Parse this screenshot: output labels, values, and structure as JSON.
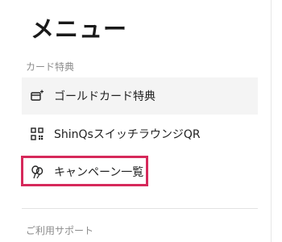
{
  "menu": {
    "title": "メニュー",
    "section_card": "カード特典",
    "section_support": "ご利用サポート",
    "items": [
      {
        "label": "ゴールドカード特典",
        "icon": "card-sparkle-icon"
      },
      {
        "label": "ShinQsスイッチラウンジQR",
        "icon": "qr-code-icon"
      },
      {
        "label": "キャンペーン一覧",
        "icon": "balloons-icon"
      }
    ]
  },
  "colors": {
    "highlight": "#d6295b",
    "shaded_row": "#f4f4f4",
    "section_label": "#8c8c8c"
  }
}
